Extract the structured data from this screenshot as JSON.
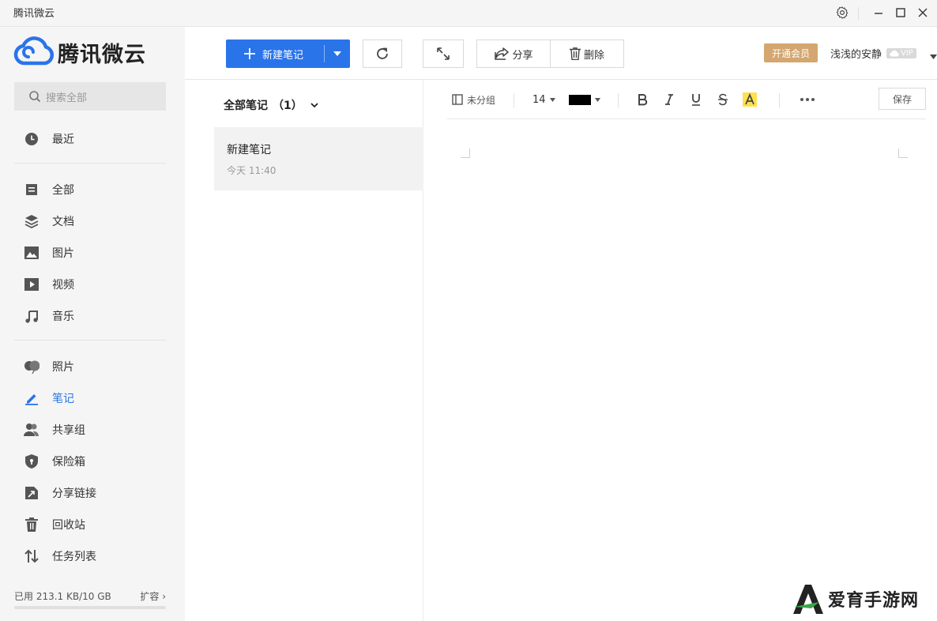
{
  "window": {
    "title": "腾讯微云"
  },
  "sidebar": {
    "logo_text": "腾讯微云",
    "search_placeholder": "搜索全部",
    "nav": {
      "recent": "最近",
      "all": "全部",
      "docs": "文档",
      "images": "图片",
      "video": "视频",
      "music": "音乐",
      "photos": "照片",
      "notes": "笔记",
      "shared_group": "共享组",
      "safe": "保险箱",
      "share_links": "分享链接",
      "recycle": "回收站",
      "tasks": "任务列表"
    },
    "active_item": "笔记",
    "storage_text": "已用 213.1 KB/10 GB",
    "expand_label": "扩容",
    "storage_fraction": 0.0
  },
  "toolbar": {
    "new_note": "新建笔记",
    "share": "分享",
    "delete": "删除",
    "vip_button": "开通会员",
    "username": "浅浅的安静",
    "vip_badge": "VIP"
  },
  "notes": {
    "header": "全部笔记",
    "count": "（1）",
    "items": [
      {
        "title": "新建笔记",
        "time": "今天 11:40"
      }
    ]
  },
  "editor": {
    "group": "未分组",
    "font_size": "14",
    "save": "保存",
    "text_color": "#000000",
    "highlight_color": "#ffe14d"
  },
  "watermark": {
    "text": "爱育手游网"
  },
  "colors": {
    "accent": "#2a74ea",
    "vip": "#d4a670"
  }
}
